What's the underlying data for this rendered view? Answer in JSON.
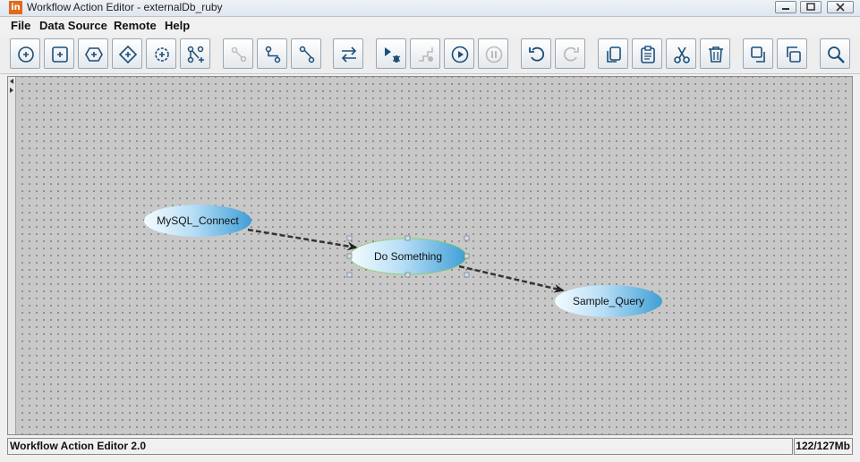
{
  "window": {
    "app_icon_text": "in",
    "title": "Workflow Action Editor - externalDb_ruby",
    "buttons": [
      "minimize",
      "maximize",
      "close"
    ]
  },
  "menu": [
    "File",
    "Data Source",
    "Remote",
    "Help"
  ],
  "toolbar": [
    {
      "icon": "add-circle-icon",
      "enabled": true
    },
    {
      "icon": "add-square-icon",
      "enabled": true
    },
    {
      "icon": "add-hexagon-icon",
      "enabled": true
    },
    {
      "icon": "add-diamond-icon",
      "enabled": true
    },
    {
      "icon": "add-gear-icon",
      "enabled": true
    },
    {
      "icon": "add-fork-icon",
      "enabled": true
    },
    {
      "icon": "connect-icon",
      "enabled": false
    },
    {
      "icon": "link-down-icon",
      "enabled": true
    },
    {
      "icon": "link-up-icon",
      "enabled": true
    },
    {
      "icon": "swap-icon",
      "enabled": true
    },
    {
      "icon": "debug-icon",
      "enabled": true
    },
    {
      "icon": "step-icon",
      "enabled": false
    },
    {
      "icon": "play-icon",
      "enabled": true
    },
    {
      "icon": "pause-icon",
      "enabled": false
    },
    {
      "icon": "undo-icon",
      "enabled": true
    },
    {
      "icon": "redo-icon",
      "enabled": false
    },
    {
      "icon": "copy-icon",
      "enabled": true
    },
    {
      "icon": "paste-icon",
      "enabled": true
    },
    {
      "icon": "cut-icon",
      "enabled": true
    },
    {
      "icon": "delete-icon",
      "enabled": true
    },
    {
      "icon": "bring-front-icon",
      "enabled": true
    },
    {
      "icon": "send-back-icon",
      "enabled": true
    },
    {
      "icon": "zoom-icon",
      "enabled": true
    }
  ],
  "graph": {
    "nodes": [
      {
        "id": "mysql",
        "label": "MySQL_Connect",
        "selected": false
      },
      {
        "id": "dosomething",
        "label": "Do Something",
        "selected": true
      },
      {
        "id": "sample",
        "label": "Sample_Query",
        "selected": false
      }
    ],
    "edges": [
      {
        "from": "MySQL_Connect",
        "to": "Do Something"
      },
      {
        "from": "Do Something",
        "to": "Sample_Query"
      }
    ]
  },
  "status": {
    "text": "Workflow Action Editor 2.0",
    "memory": "122/127Mb"
  },
  "colors": {
    "node_fill_light": "#eaf6ff",
    "node_fill_dark": "#3f9fd6",
    "canvas_bg": "#c8c8c8",
    "selection": "#7ad14a"
  }
}
